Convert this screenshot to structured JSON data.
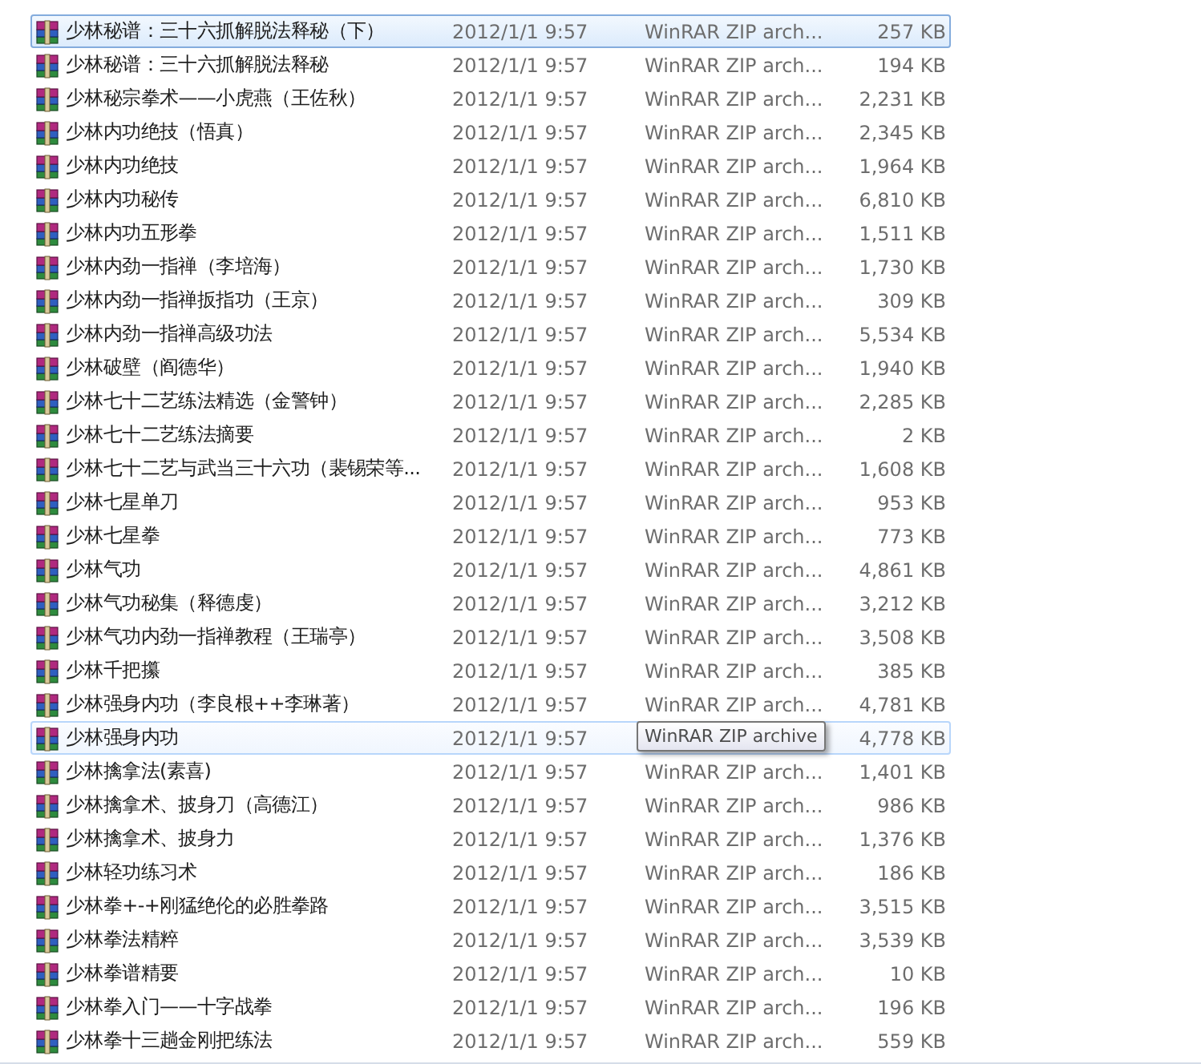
{
  "rows": [
    {
      "name": "少林秘谱：三十六抓解脱法释秘（下）",
      "date": "2012/1/1 9:57",
      "type": "WinRAR ZIP arch...",
      "size": "257 KB",
      "selected": true,
      "hovered": false
    },
    {
      "name": "少林秘谱：三十六抓解脱法释秘",
      "date": "2012/1/1 9:57",
      "type": "WinRAR ZIP arch...",
      "size": "194 KB",
      "selected": false,
      "hovered": false
    },
    {
      "name": "少林秘宗拳术——小虎燕（王佐秋）",
      "date": "2012/1/1 9:57",
      "type": "WinRAR ZIP arch...",
      "size": "2,231 KB",
      "selected": false,
      "hovered": false
    },
    {
      "name": "少林内功绝技（悟真）",
      "date": "2012/1/1 9:57",
      "type": "WinRAR ZIP arch...",
      "size": "2,345 KB",
      "selected": false,
      "hovered": false
    },
    {
      "name": "少林内功绝技",
      "date": "2012/1/1 9:57",
      "type": "WinRAR ZIP arch...",
      "size": "1,964 KB",
      "selected": false,
      "hovered": false
    },
    {
      "name": "少林内功秘传",
      "date": "2012/1/1 9:57",
      "type": "WinRAR ZIP arch...",
      "size": "6,810 KB",
      "selected": false,
      "hovered": false
    },
    {
      "name": "少林内功五形拳",
      "date": "2012/1/1 9:57",
      "type": "WinRAR ZIP arch...",
      "size": "1,511 KB",
      "selected": false,
      "hovered": false
    },
    {
      "name": "少林内劲一指禅（李培海）",
      "date": "2012/1/1 9:57",
      "type": "WinRAR ZIP arch...",
      "size": "1,730 KB",
      "selected": false,
      "hovered": false
    },
    {
      "name": "少林内劲一指禅扳指功（王京）",
      "date": "2012/1/1 9:57",
      "type": "WinRAR ZIP arch...",
      "size": "309 KB",
      "selected": false,
      "hovered": false
    },
    {
      "name": "少林内劲一指禅高级功法",
      "date": "2012/1/1 9:57",
      "type": "WinRAR ZIP arch...",
      "size": "5,534 KB",
      "selected": false,
      "hovered": false
    },
    {
      "name": "少林破壁（阎德华）",
      "date": "2012/1/1 9:57",
      "type": "WinRAR ZIP arch...",
      "size": "1,940 KB",
      "selected": false,
      "hovered": false
    },
    {
      "name": "少林七十二艺练法精选（金警钟）",
      "date": "2012/1/1 9:57",
      "type": "WinRAR ZIP arch...",
      "size": "2,285 KB",
      "selected": false,
      "hovered": false
    },
    {
      "name": "少林七十二艺练法摘要",
      "date": "2012/1/1 9:57",
      "type": "WinRAR ZIP arch...",
      "size": "2 KB",
      "selected": false,
      "hovered": false
    },
    {
      "name": "少林七十二艺与武当三十六功（裴锡荣等...",
      "date": "2012/1/1 9:57",
      "type": "WinRAR ZIP arch...",
      "size": "1,608 KB",
      "selected": false,
      "hovered": false
    },
    {
      "name": "少林七星单刀",
      "date": "2012/1/1 9:57",
      "type": "WinRAR ZIP arch...",
      "size": "953 KB",
      "selected": false,
      "hovered": false
    },
    {
      "name": "少林七星拳",
      "date": "2012/1/1 9:57",
      "type": "WinRAR ZIP arch...",
      "size": "773 KB",
      "selected": false,
      "hovered": false
    },
    {
      "name": "少林气功",
      "date": "2012/1/1 9:57",
      "type": "WinRAR ZIP arch...",
      "size": "4,861 KB",
      "selected": false,
      "hovered": false
    },
    {
      "name": "少林气功秘集（释德虔）",
      "date": "2012/1/1 9:57",
      "type": "WinRAR ZIP arch...",
      "size": "3,212 KB",
      "selected": false,
      "hovered": false
    },
    {
      "name": "少林气功内劲一指禅教程（王瑞亭）",
      "date": "2012/1/1 9:57",
      "type": "WinRAR ZIP arch...",
      "size": "3,508 KB",
      "selected": false,
      "hovered": false
    },
    {
      "name": "少林千把攥",
      "date": "2012/1/1 9:57",
      "type": "WinRAR ZIP arch...",
      "size": "385 KB",
      "selected": false,
      "hovered": false
    },
    {
      "name": "少林强身内功（李良根++李琳著）",
      "date": "2012/1/1 9:57",
      "type": "WinRAR ZIP arch...",
      "size": "4,781 KB",
      "selected": false,
      "hovered": false
    },
    {
      "name": "少林强身内功",
      "date": "2012/1/1 9:57",
      "tooltip": "WinRAR ZIP archive",
      "size": "4,778 KB",
      "selected": false,
      "hovered": true
    },
    {
      "name": "少林擒拿法(素喜)",
      "date": "2012/1/1 9:57",
      "type": "WinRAR ZIP arch...",
      "size": "1,401 KB",
      "selected": false,
      "hovered": false
    },
    {
      "name": "少林擒拿术、披身刀（高德江）",
      "date": "2012/1/1 9:57",
      "type": "WinRAR ZIP arch...",
      "size": "986 KB",
      "selected": false,
      "hovered": false
    },
    {
      "name": "少林擒拿术、披身力",
      "date": "2012/1/1 9:57",
      "type": "WinRAR ZIP arch...",
      "size": "1,376 KB",
      "selected": false,
      "hovered": false
    },
    {
      "name": "少林轻功练习术",
      "date": "2012/1/1 9:57",
      "type": "WinRAR ZIP arch...",
      "size": "186 KB",
      "selected": false,
      "hovered": false
    },
    {
      "name": "少林拳+-+刚猛绝伦的必胜拳路",
      "date": "2012/1/1 9:57",
      "type": "WinRAR ZIP arch...",
      "size": "3,515 KB",
      "selected": false,
      "hovered": false
    },
    {
      "name": "少林拳法精粹",
      "date": "2012/1/1 9:57",
      "type": "WinRAR ZIP arch...",
      "size": "3,539 KB",
      "selected": false,
      "hovered": false
    },
    {
      "name": "少林拳谱精要",
      "date": "2012/1/1 9:57",
      "type": "WinRAR ZIP arch...",
      "size": "10 KB",
      "selected": false,
      "hovered": false
    },
    {
      "name": "少林拳入门——十字战拳",
      "date": "2012/1/1 9:57",
      "type": "WinRAR ZIP arch...",
      "size": "196 KB",
      "selected": false,
      "hovered": false
    },
    {
      "name": "少林拳十三趟金刚把练法",
      "date": "2012/1/1 9:57",
      "type": "WinRAR ZIP arch...",
      "size": "559 KB",
      "selected": false,
      "hovered": false
    }
  ]
}
